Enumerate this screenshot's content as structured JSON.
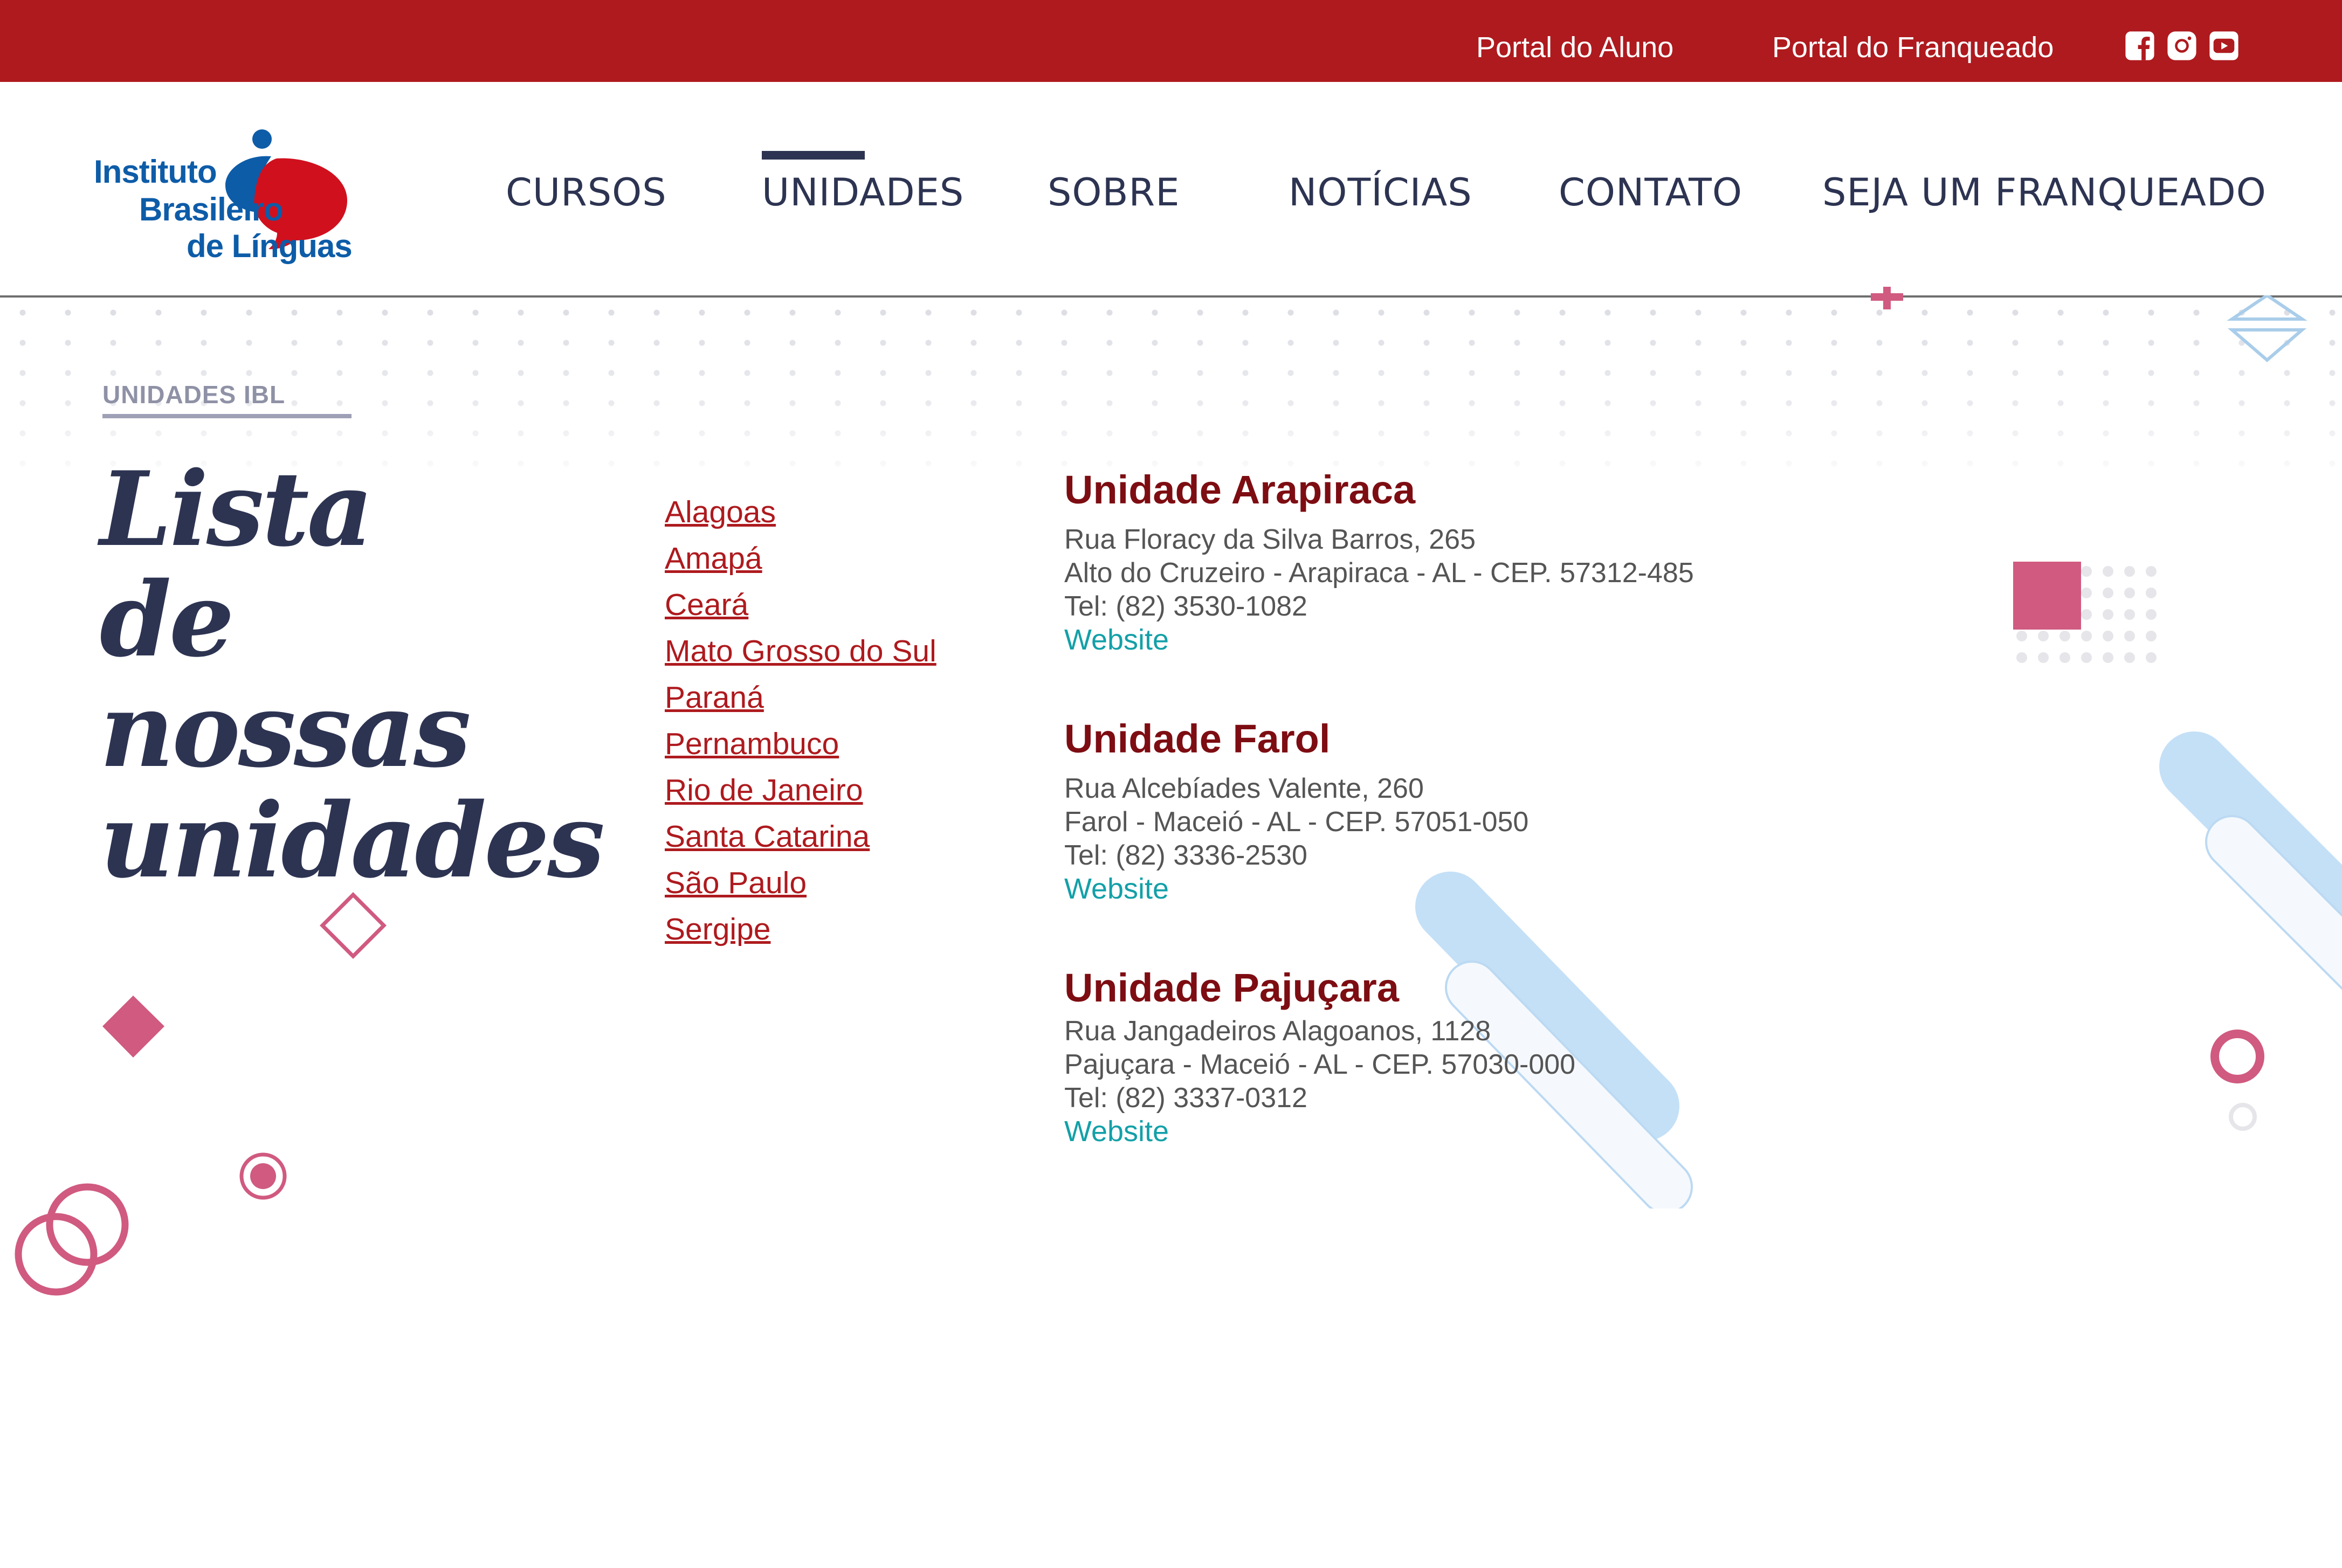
{
  "topbar": {
    "links": [
      {
        "label": "Portal do Aluno"
      },
      {
        "label": "Portal do Franqueado"
      }
    ],
    "social_icons": [
      "facebook-icon",
      "instagram-icon",
      "youtube-icon"
    ]
  },
  "header": {
    "logo": {
      "line1": "Instituto",
      "line2": "Brasileiro",
      "line3": "de Línguas"
    },
    "nav": [
      {
        "label": "CURSOS",
        "active": false
      },
      {
        "label": "UNIDADES",
        "active": true
      },
      {
        "label": "SOBRE",
        "active": false
      },
      {
        "label": "NOTÍCIAS",
        "active": false
      },
      {
        "label": "CONTATO",
        "active": false
      },
      {
        "label": "SEJA UM FRANQUEADO",
        "active": false
      }
    ]
  },
  "main": {
    "eyebrow": "UNIDADES IBL",
    "title_lines": [
      "Lista de",
      "nossas",
      "unidades"
    ],
    "states": [
      "Alagoas",
      "Amapá",
      "Ceará",
      "Mato Grosso do Sul",
      "Paraná",
      "Pernambuco",
      "Rio de Janeiro",
      "Santa Catarina",
      "São Paulo",
      "Sergipe"
    ],
    "units": [
      {
        "name": "Unidade Arapiraca",
        "address": "Rua Floracy da Silva Barros, 265",
        "district": "Alto do Cruzeiro - Arapiraca - AL - CEP. 57312-485",
        "phone": "Tel: (82) 3530-1082",
        "website_label": "Website"
      },
      {
        "name": "Unidade Farol",
        "address": "Rua Alcebíades Valente, 260",
        "district": "Farol - Maceió - AL - CEP. 57051-050",
        "phone": "Tel: (82) 3336-2530",
        "website_label": "Website"
      },
      {
        "name": "Unidade Pajuçara",
        "address": "Rua Jangadeiros Alagoanos, 1128",
        "district": "Pajuçara - Maceió - AL - CEP. 57030-000",
        "phone": "Tel: (82) 3337-0312",
        "website_label": "Website"
      }
    ]
  },
  "colors": {
    "topbar": "#ae1a1e",
    "nav_text": "#2d3452",
    "state_link": "#ae1a1e",
    "unit_title": "#7d0d12",
    "website_link": "#13a0a8",
    "deco_pink": "#d05a80",
    "deco_blue": "#bfdcf5"
  }
}
